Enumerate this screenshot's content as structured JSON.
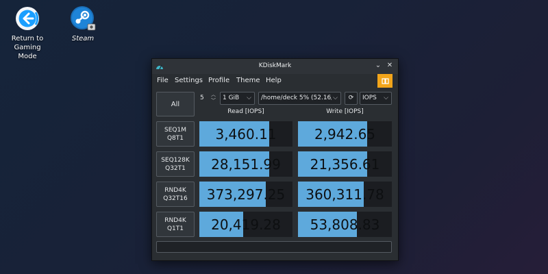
{
  "desktop": {
    "icons": [
      {
        "label_line1": "Return to",
        "label_line2": "Gaming Mode",
        "icon": "return-arrow-icon"
      },
      {
        "label": "Steam",
        "icon": "steam-icon"
      }
    ]
  },
  "window": {
    "title": "KDiskMark",
    "controls": {
      "minimize": "⌄",
      "close": "✕"
    }
  },
  "menu": {
    "items": [
      "File",
      "Settings",
      "Profile",
      "Theme",
      "Help"
    ]
  },
  "toolbar": {
    "all_label": "All",
    "count": "5",
    "size": "1 GiB",
    "path": "/home/deck 5% (52.16/9",
    "mode": "IOPS"
  },
  "headers": {
    "read": "Read [IOPS]",
    "write": "Write [IOPS]"
  },
  "tests": [
    {
      "line1": "SEQ1M",
      "line2": "Q8T1",
      "read": "3,460.11",
      "read_fill": 0.75,
      "write": "2,942.65",
      "write_fill": 0.74
    },
    {
      "line1": "SEQ128K",
      "line2": "Q32T1",
      "read": "28,151.99",
      "read_fill": 0.75,
      "write": "21,356.61",
      "write_fill": 0.74
    },
    {
      "line1": "RND4K",
      "line2": "Q32T16",
      "read": "373,297.25",
      "read_fill": 0.71,
      "write": "360,311.78",
      "write_fill": 0.7
    },
    {
      "line1": "RND4K",
      "line2": "Q1T1",
      "read": "20,419.28",
      "read_fill": 0.47,
      "write": "53,808.83",
      "write_fill": 0.63
    }
  ],
  "colors": {
    "bar": "#5ea9dc",
    "accent": "#f2a51a",
    "window_bg": "#2a2e32"
  }
}
